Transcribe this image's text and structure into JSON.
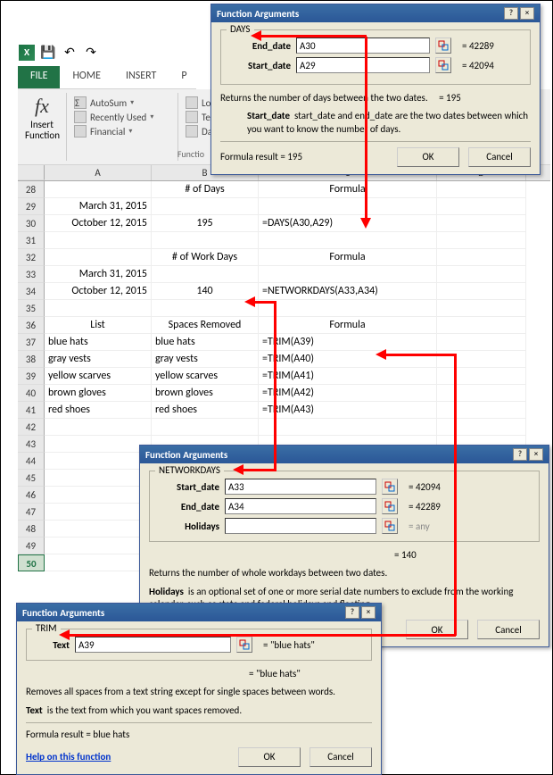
{
  "qat": {
    "save": "💾",
    "undo": "↶",
    "redo": "↷"
  },
  "tabs": {
    "file": "FILE",
    "home": "HOME",
    "insert": "INSERT",
    "p": "P"
  },
  "ribbon": {
    "insert_fn": "Insert\nFunction",
    "autosum": "AutoSum",
    "recently": "Recently Used",
    "financial": "Financial",
    "logi": "Logi",
    "text": "Text",
    "date": "Date",
    "group_label": "Functio"
  },
  "cols": [
    "A",
    "B",
    "C",
    "D"
  ],
  "rows": [
    {
      "n": 28,
      "a": "",
      "b": "# of Days",
      "c": "Formula",
      "d": "",
      "hdr": true
    },
    {
      "n": 29,
      "a": "March 31, 2015",
      "b": "",
      "c": "",
      "d": ""
    },
    {
      "n": 30,
      "a": "October 12, 2015",
      "b": "195",
      "c": "=DAYS(A30,A29)",
      "d": ""
    },
    {
      "n": 31,
      "a": "",
      "b": "",
      "c": "",
      "d": ""
    },
    {
      "n": 32,
      "a": "",
      "b": "# of Work Days",
      "c": "Formula",
      "d": "",
      "hdr": true
    },
    {
      "n": 33,
      "a": "March 31, 2015",
      "b": "",
      "c": "",
      "d": ""
    },
    {
      "n": 34,
      "a": "October 12, 2015",
      "b": "140",
      "c": "=NETWORKDAYS(A33,A34)",
      "d": ""
    },
    {
      "n": 35,
      "a": "",
      "b": "",
      "c": "",
      "d": ""
    },
    {
      "n": 36,
      "a": "List",
      "b": "Spaces Removed",
      "c": "Formula",
      "d": "",
      "hdr": true
    },
    {
      "n": 37,
      "a": "blue  hats",
      "b": "blue hats",
      "c": "=TRIM(A39)",
      "d": ""
    },
    {
      "n": 38,
      "a": "gray  vests",
      "b": "gray vests",
      "c": "=TRIM(A40)",
      "d": ""
    },
    {
      "n": 39,
      "a": "yellow  scarves",
      "b": "yellow scarves",
      "c": "=TRIM(A41)",
      "d": ""
    },
    {
      "n": 40,
      "a": " brown gloves",
      "b": "brown gloves",
      "c": "=TRIM(A42)",
      "d": ""
    },
    {
      "n": 41,
      "a": " red shoes",
      "b": "red shoes",
      "c": "=TRIM(A43)",
      "d": ""
    },
    {
      "n": 42,
      "a": "",
      "b": "",
      "c": "",
      "d": ""
    },
    {
      "n": 43,
      "a": "",
      "b": "",
      "c": "",
      "d": ""
    },
    {
      "n": 44,
      "a": "",
      "b": "",
      "c": "",
      "d": ""
    },
    {
      "n": 45,
      "a": "",
      "b": "",
      "c": "",
      "d": ""
    },
    {
      "n": 46,
      "a": "",
      "b": "",
      "c": "",
      "d": ""
    },
    {
      "n": 47,
      "a": "",
      "b": "",
      "c": "",
      "d": ""
    },
    {
      "n": 48,
      "a": "",
      "b": "",
      "c": "",
      "d": ""
    },
    {
      "n": 49,
      "a": "",
      "b": "",
      "c": "",
      "d": ""
    },
    {
      "n": 50,
      "a": "",
      "b": "",
      "c": "",
      "d": "",
      "sel": true
    }
  ],
  "dlg_days": {
    "title": "Function Arguments",
    "legend": "DAYS",
    "end_date_label": "End_date",
    "end_date_val": "A30",
    "end_date_res": "=  42289",
    "start_date_label": "Start_date",
    "start_date_val": "A29",
    "start_date_res": "=  42094",
    "desc1": "Returns the number of days between the two dates.",
    "desc1_res": "=   195",
    "desc2_label": "Start_date",
    "desc2_text": "start_date and end_date are the two dates between which you want to know the number of days.",
    "result_label": "Formula result =   195",
    "ok": "OK",
    "cancel": "Cancel"
  },
  "dlg_nwd": {
    "title": "Function Arguments",
    "legend": "NETWORKDAYS",
    "start_label": "Start_date",
    "start_val": "A33",
    "start_res": "=  42094",
    "end_label": "End_date",
    "end_val": "A34",
    "end_res": "=  42289",
    "hol_label": "Holidays",
    "hol_val": "",
    "hol_res": "=  any",
    "calc_res": "=   140",
    "desc1": "Returns the number of whole workdays between two dates.",
    "desc2_label": "Holidays",
    "desc2_text": "is an optional set of one or more serial date numbers to exclude from the working calendar, such as state and federal holidays and floating",
    "ok": "OK",
    "cancel": "Cancel"
  },
  "dlg_trim": {
    "title": "Function Arguments",
    "legend": "TRIM",
    "text_label": "Text",
    "text_val": "A39",
    "text_res": "=   \"blue  hats\"",
    "calc_res": "=  \"blue hats\"",
    "desc1": "Removes all spaces from a text string except for single spaces between words.",
    "desc2_label": "Text",
    "desc2_text": "is the text from which you want spaces removed.",
    "result_label": "Formula result =    blue hats",
    "help": "Help on this function",
    "ok": "OK",
    "cancel": "Cancel"
  }
}
